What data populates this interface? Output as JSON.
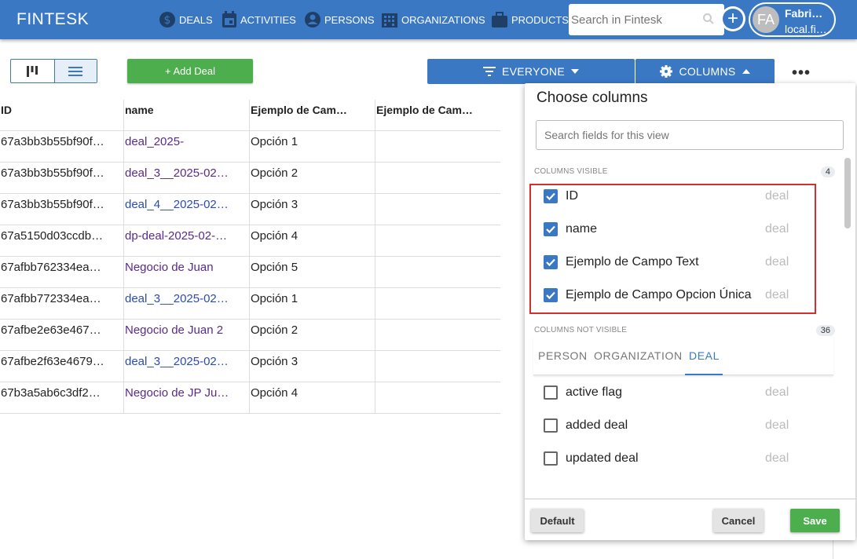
{
  "app": {
    "brand": "FINTESK",
    "nav": [
      {
        "label": "DEALS",
        "icon": "dollar-icon"
      },
      {
        "label": "ACTIVITIES",
        "icon": "calendar-icon"
      },
      {
        "label": "PERSONS",
        "icon": "person-icon"
      },
      {
        "label": "ORGANIZATIONS",
        "icon": "building-icon"
      },
      {
        "label": "PRODUCTS",
        "icon": "briefcase-icon"
      }
    ],
    "search_placeholder": "Search in Fintesk",
    "user": {
      "initials": "FA",
      "name": "Fabri…",
      "email": "local.fi…"
    },
    "accent": "#3a78c4"
  },
  "toolbar": {
    "add_deal": "+ Add Deal",
    "everyone": "EVERYONE",
    "columns": "COLUMNS",
    "more": "•••"
  },
  "table": {
    "headers": [
      "ID",
      "name",
      "Ejemplo de Cam…",
      "Ejemplo de Cam…"
    ],
    "rows": [
      [
        "67a3bb3b55bf90f…",
        "deal_2025-",
        "Opción 1",
        ""
      ],
      [
        "67a3bb3b55bf90f…",
        "deal_3__2025-02…",
        "Opción 2",
        ""
      ],
      [
        "67a3bb3b55bf90f…",
        "deal_4__2025-02…",
        "Opción 3",
        ""
      ],
      [
        "67a5150d03ccdb…",
        "dp-deal-2025-02-…",
        "Opción 4",
        ""
      ],
      [
        "67afbb762334ea…",
        "Negocio de Juan",
        "Opción 5",
        ""
      ],
      [
        "67afbb772334ea…",
        "deal_3__2025-02…",
        "Opción 1",
        ""
      ],
      [
        "67afbe2e63e467…",
        "Negocio de Juan 2",
        "Opción 2",
        ""
      ],
      [
        "67afbe2f63e4679…",
        "deal_3__2025-02…",
        "Opción 3",
        ""
      ],
      [
        "67b3a5ab6c3df2…",
        "Negocio de JP Ju…",
        "Opción 4",
        ""
      ]
    ]
  },
  "panel": {
    "title": "Choose columns",
    "search_placeholder": "Search fields for this view",
    "visible_label": "COLUMNS VISIBLE",
    "visible_count": "4",
    "visible": [
      {
        "name": "ID",
        "type": "deal"
      },
      {
        "name": "name",
        "type": "deal"
      },
      {
        "name": "Ejemplo de Campo Text",
        "type": "deal"
      },
      {
        "name": "Ejemplo de Campo Opcion Única",
        "type": "deal"
      }
    ],
    "not_visible_label": "COLUMNS NOT VISIBLE",
    "not_visible_count": "36",
    "tabs": [
      "PERSON",
      "ORGANIZATION",
      "DEAL"
    ],
    "not_visible": [
      {
        "name": "active flag",
        "type": "deal"
      },
      {
        "name": "added deal",
        "type": "deal"
      },
      {
        "name": "updated deal",
        "type": "deal"
      }
    ],
    "default_label": "Default",
    "cancel_label": "Cancel",
    "save_label": "Save"
  }
}
